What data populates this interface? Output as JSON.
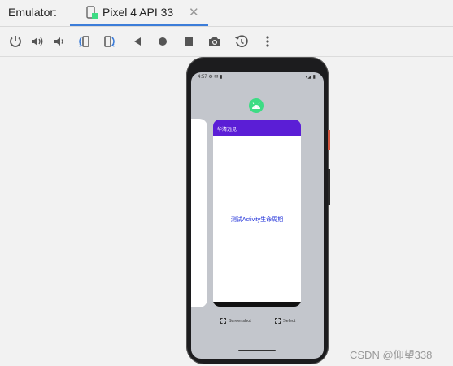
{
  "tabbar": {
    "label": "Emulator:",
    "tab_title": "Pixel 4 API 33",
    "close_glyph": "✕",
    "accent": "#3c7dd9"
  },
  "toolbar": {
    "icons": [
      "power-icon",
      "volume-up-icon",
      "volume-down-icon",
      "rotate-left-icon",
      "rotate-right-icon",
      "back-icon",
      "home-icon",
      "overview-icon",
      "camera-icon",
      "snapshot-icon",
      "more-icon"
    ]
  },
  "device": {
    "status_left": "4:57 ⚙ ✉ ▮",
    "status_right": "▾◢ ▮",
    "card_title": "华清远见",
    "card_text": "测试Activity生命周期",
    "card_bar_color": "#5b1ed6",
    "screenshot_label": "Screenshot",
    "select_label": "Select"
  },
  "watermark": "CSDN @仰望338"
}
